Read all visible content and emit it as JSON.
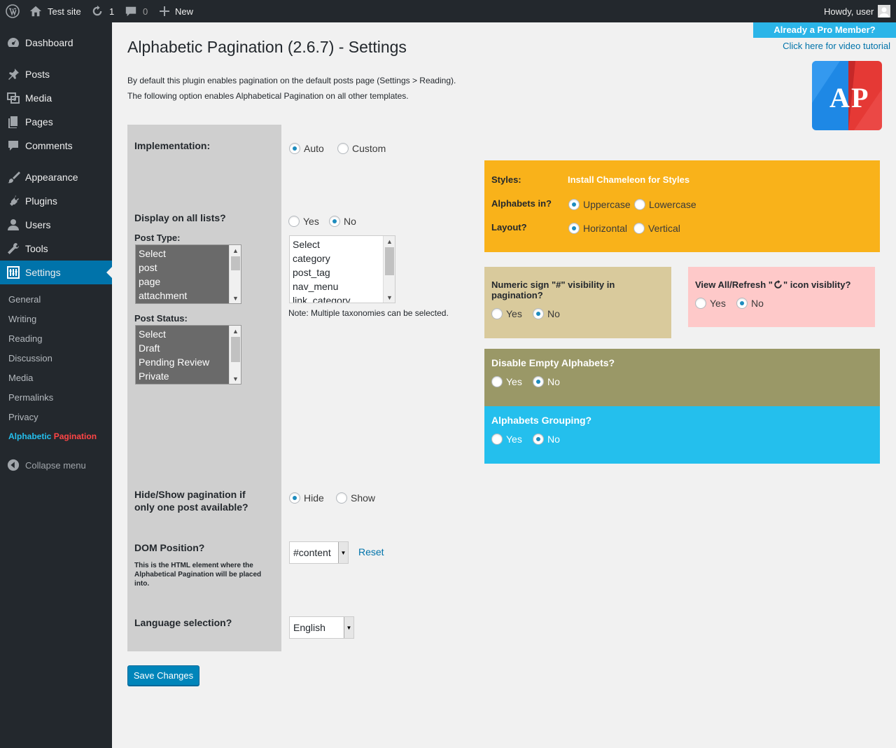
{
  "adminbar": {
    "site_name": "Test site",
    "updates_count": "1",
    "comments_count": "0",
    "new_label": "New",
    "howdy": "Howdy, user"
  },
  "sidebar": {
    "items": [
      {
        "label": "Dashboard",
        "icon": "dashboard-icon"
      },
      {
        "label": "Posts",
        "icon": "pin-icon"
      },
      {
        "label": "Media",
        "icon": "media-icon"
      },
      {
        "label": "Pages",
        "icon": "pages-icon"
      },
      {
        "label": "Comments",
        "icon": "comment-icon"
      },
      {
        "label": "Appearance",
        "icon": "brush-icon"
      },
      {
        "label": "Plugins",
        "icon": "plug-icon"
      },
      {
        "label": "Users",
        "icon": "user-icon"
      },
      {
        "label": "Tools",
        "icon": "wrench-icon"
      },
      {
        "label": "Settings",
        "icon": "settings-icon"
      }
    ],
    "submenu": [
      "General",
      "Writing",
      "Reading",
      "Discussion",
      "Media",
      "Permalinks",
      "Privacy"
    ],
    "plugin_sub_a": "Alphabetic",
    "plugin_sub_b": "Pagination",
    "collapse": "Collapse menu"
  },
  "page": {
    "title": "Alphabetic Pagination (2.6.7) - Settings",
    "intro_1": "By default this plugin enables pagination on the default posts page (Settings > Reading).",
    "intro_2": "The following option enables Alphabetical Pagination on all other templates.",
    "pro_label": "Already a Pro Member?",
    "video_link": "Click here for video tutorial",
    "logo_letters": "AP"
  },
  "form": {
    "implementation": {
      "label": "Implementation:",
      "opt1": "Auto",
      "opt2": "Custom",
      "selected": "Auto"
    },
    "display_all": {
      "label": "Display on all lists?",
      "opt1": "Yes",
      "opt2": "No",
      "selected": "No"
    },
    "post_type": {
      "label": "Post Type:",
      "options": [
        "Select",
        "post",
        "page",
        "attachment"
      ]
    },
    "taxonomies": {
      "options": [
        "Select",
        "category",
        "post_tag",
        "nav_menu",
        "link_category"
      ],
      "note": "Note: Multiple taxonomies can be selected."
    },
    "post_status": {
      "label": "Post Status:",
      "options": [
        "Select",
        "Draft",
        "Pending Review",
        "Private"
      ]
    },
    "hide_show": {
      "label_1": "Hide/Show pagination if",
      "label_2": "only one post available?",
      "opt1": "Hide",
      "opt2": "Show",
      "selected": "Hide"
    },
    "dom_position": {
      "label": "DOM Position?",
      "value": "#content",
      "reset": "Reset",
      "note": "This is the HTML element where the Alphabetical Pagination will be placed into."
    },
    "language": {
      "label": "Language selection?",
      "value": "English"
    },
    "save": "Save Changes"
  },
  "styles_box": {
    "color": "#f9b21a",
    "styles_label": "Styles:",
    "chameleon": "Install Chameleon for Styles",
    "alphabets_label": "Alphabets in?",
    "alpha_opt1": "Uppercase",
    "alpha_opt2": "Lowercase",
    "layout_label": "Layout?",
    "layout_opt1": "Horizontal",
    "layout_opt2": "Vertical"
  },
  "numeric_box": {
    "color": "#d9ca9c",
    "label_1": "Numeric sign \"#\" visibility in",
    "label_2": "pagination?",
    "opt1": "Yes",
    "opt2": "No"
  },
  "viewall_box": {
    "color": "#fec9c9",
    "label_a": "View All/Refresh \"",
    "label_b": "\" icon visiblity?",
    "opt1": "Yes",
    "opt2": "No"
  },
  "empty_box": {
    "color": "#9a9867",
    "label": "Disable Empty Alphabets?",
    "opt1": "Yes",
    "opt2": "No"
  },
  "grouping_box": {
    "color": "#24bfed",
    "label": "Alphabets Grouping?",
    "opt1": "Yes",
    "opt2": "No"
  }
}
